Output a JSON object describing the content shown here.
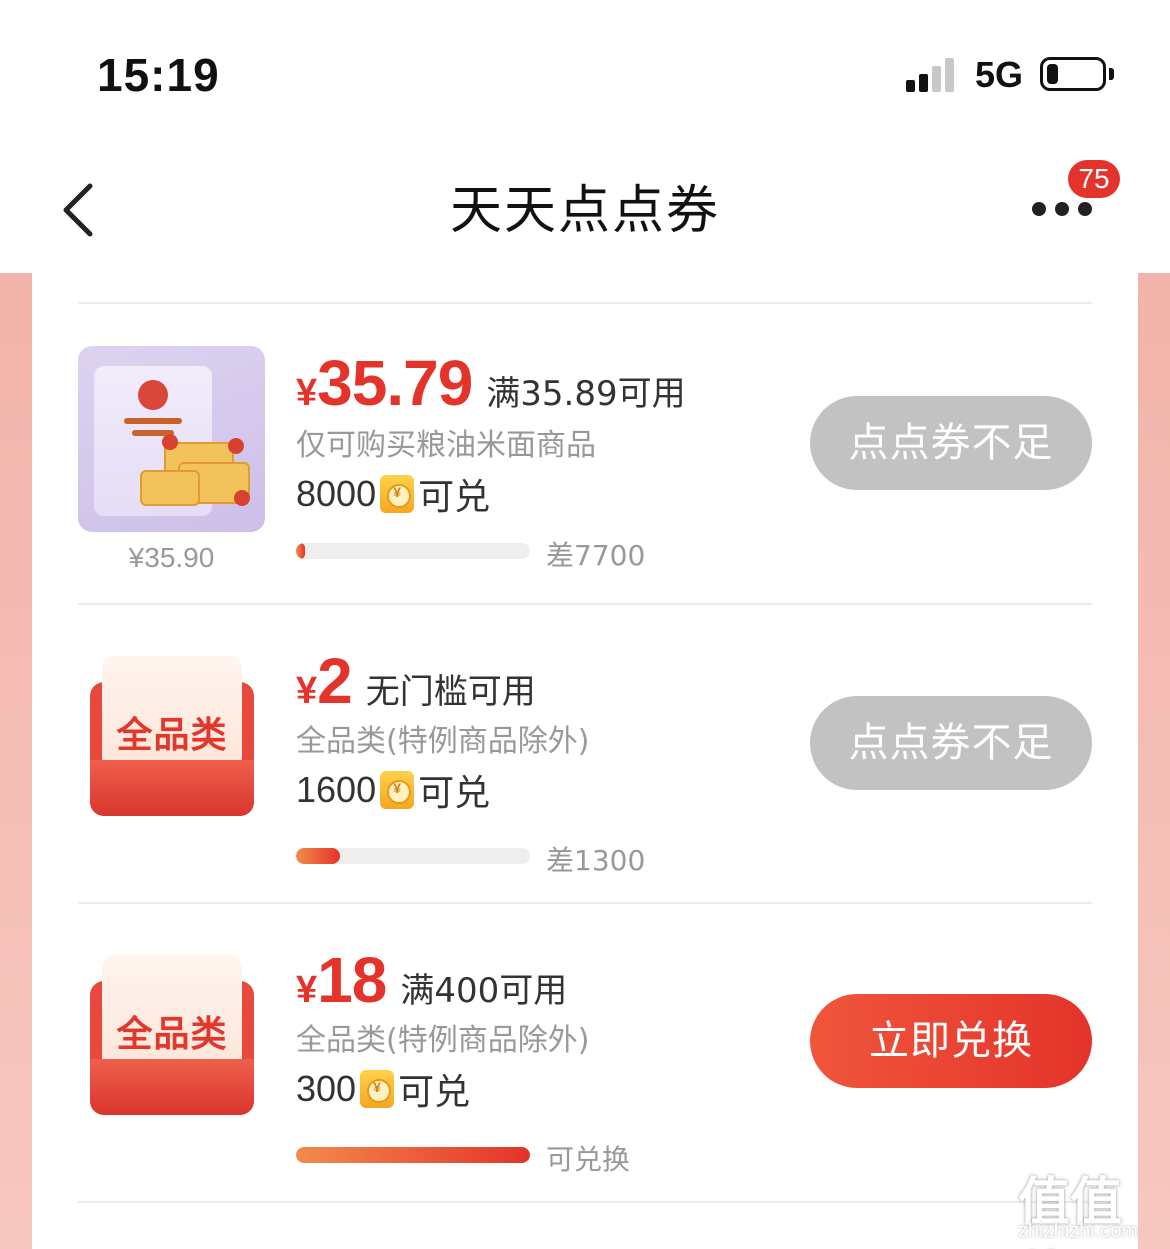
{
  "status_bar": {
    "time": "15:19",
    "network": "5G",
    "signal_level": 2,
    "battery_level": 0.2
  },
  "nav": {
    "title": "天天点点券",
    "badge_count": "75",
    "icons": [
      "back-chevron-icon",
      "more-dots-icon"
    ]
  },
  "coupons": [
    {
      "thumb_type": "product",
      "original_price": "¥35.90",
      "currency": "¥",
      "amount": "35.79",
      "condition": "满35.89可用",
      "scope": "仅可购买粮油米面商品",
      "cost": "8000",
      "cost_suffix": "可兑",
      "progress": 0.04,
      "progress_text": "差7700",
      "button_label": "点点券不足",
      "button_state": "disabled"
    },
    {
      "thumb_type": "category",
      "category_label": "全品类",
      "currency": "¥",
      "amount": "2",
      "condition": "无门槛可用",
      "scope": "全品类(特例商品除外)",
      "cost": "1600",
      "cost_suffix": "可兑",
      "progress": 0.19,
      "progress_text": "差1300",
      "button_label": "点点券不足",
      "button_state": "disabled"
    },
    {
      "thumb_type": "category",
      "category_label": "全品类",
      "currency": "¥",
      "amount": "18",
      "condition": "满400可用",
      "scope": "全品类(特例商品除外)",
      "cost": "300",
      "cost_suffix": "可兑",
      "progress": 1.0,
      "progress_text": "可兑换",
      "button_label": "立即兑换",
      "button_state": "active"
    }
  ],
  "coin_icon_symbol": "¥",
  "watermark": {
    "glyphs": "值值值",
    "url": "zhizhizhi.com"
  },
  "colors": {
    "accent_red": "#e4332a",
    "disabled_gray": "#c2c2c2",
    "side_pink": "#f2b4aa"
  }
}
